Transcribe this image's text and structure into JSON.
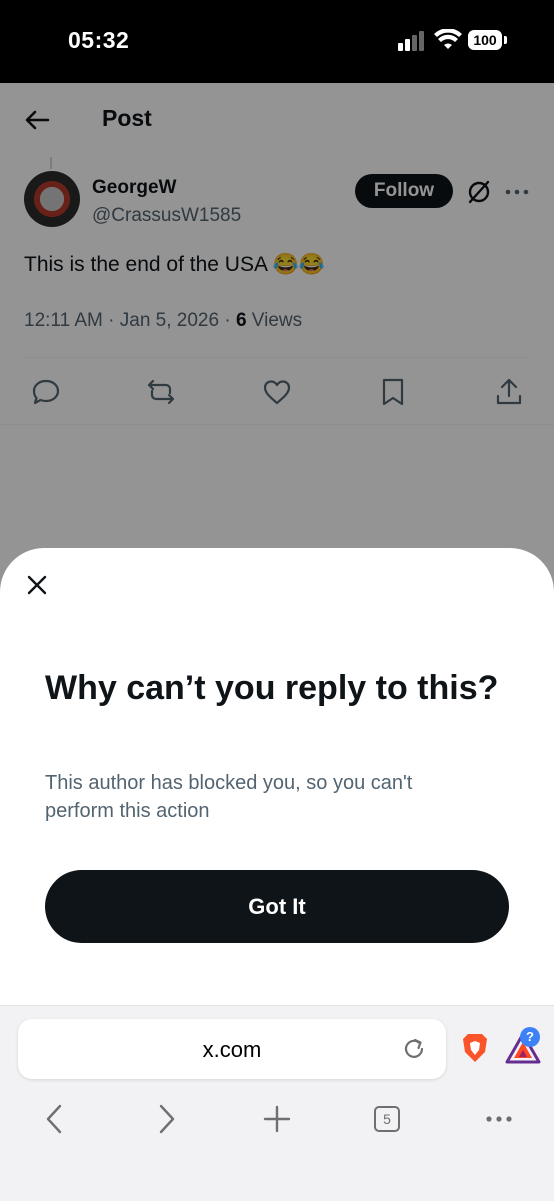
{
  "status_bar": {
    "time": "05:32",
    "battery": "100"
  },
  "header": {
    "title": "Post"
  },
  "post": {
    "author_name": "GeorgeW",
    "author_handle": "@CrassusW1585",
    "follow_label": "Follow",
    "text": "This is the end of the USA 😂😂",
    "meta_prefix": "12:11 AM · Jan 5, 2026 · ",
    "views_count": "6",
    "views_label": " Views"
  },
  "sheet": {
    "title": "Why can’t you reply to this?",
    "description": "This author has blocked you, so you can't perform this action",
    "button_label": "Got It"
  },
  "browser": {
    "url": "x.com",
    "tab_count": "5",
    "rewards_badge": "?"
  },
  "colors": {
    "text_primary": "#0f1419",
    "text_secondary": "#536471",
    "button_dark": "#0f1419",
    "overlay": "rgba(0,0,0,0.42)",
    "brave_orange": "#fb542b",
    "badge_blue": "#3c82f6"
  },
  "icons": [
    "back-arrow-icon",
    "grok-icon",
    "more-icon",
    "reply-icon",
    "repost-icon",
    "like-icon",
    "bookmark-icon",
    "share-icon",
    "close-icon",
    "reload-icon",
    "brave-shields-icon",
    "brave-rewards-icon",
    "back-icon",
    "forward-icon",
    "new-tab-icon",
    "tabs-icon",
    "menu-icon"
  ]
}
